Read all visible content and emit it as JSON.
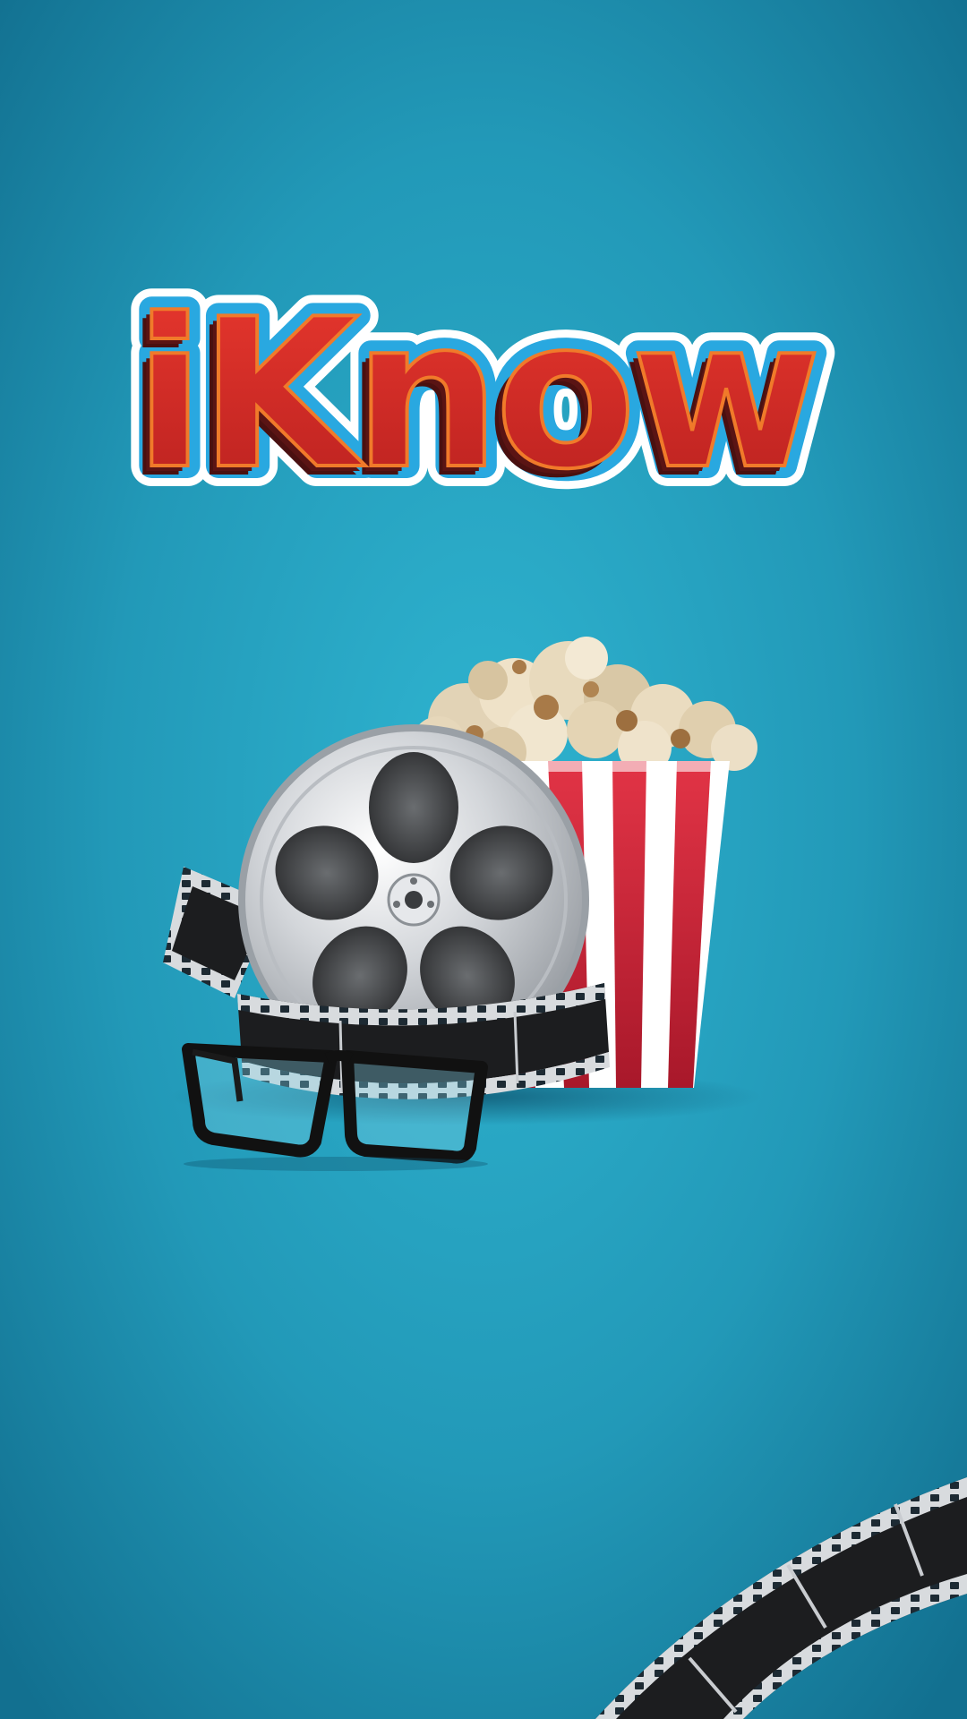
{
  "app": {
    "logo_text": "iKnow"
  },
  "colors": {
    "background_center": "#2bb0cc",
    "background_edge": "#137190",
    "logo_red": "#d22e2e",
    "logo_shadow": "#5a1414",
    "logo_outline_blue": "#29a8e0",
    "popcorn_red": "#d3283a",
    "reel_silver": "#cfd2d6"
  },
  "icons": {
    "logo": "iknow-logo",
    "film_reel": "film-reel-icon",
    "popcorn": "popcorn-bucket-icon",
    "glasses": "eyeglasses-icon",
    "film_strip": "film-strip-icon"
  }
}
